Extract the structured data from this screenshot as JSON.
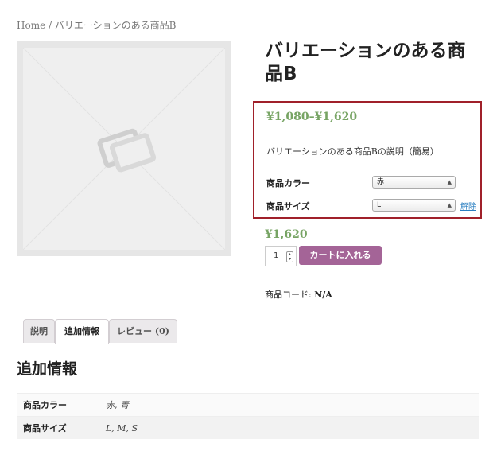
{
  "breadcrumb": {
    "home": "Home",
    "separator": " / ",
    "current": "バリエーションのある商品B"
  },
  "product": {
    "title": "バリエーションのある商品B",
    "price_range": "¥1,080–¥1,620",
    "short_description": "バリエーションのある商品Bの説明（簡易）",
    "image_icon": "placeholder-image-icon"
  },
  "variations": {
    "color": {
      "label": "商品カラー",
      "selected": "赤"
    },
    "size": {
      "label": "商品サイズ",
      "selected": "L"
    },
    "reset_label": "解除"
  },
  "purchase": {
    "single_price": "¥1,620",
    "quantity": "1",
    "add_to_cart_label": "カートに入れる"
  },
  "meta": {
    "sku_label": "商品コード:",
    "sku_value": "N/A"
  },
  "tabs": [
    {
      "label": "説明"
    },
    {
      "label": "追加情報",
      "active": true
    },
    {
      "label": "レビュー (0)"
    }
  ],
  "additional_info": {
    "title": "追加情報",
    "rows": [
      {
        "name": "商品カラー",
        "value": "赤, 青"
      },
      {
        "name": "商品サイズ",
        "value": "L, M, S"
      }
    ]
  },
  "colors": {
    "price": "#77a464",
    "button": "#a46497",
    "highlight_border": "#a0202a",
    "link": "#2a7fc1"
  }
}
